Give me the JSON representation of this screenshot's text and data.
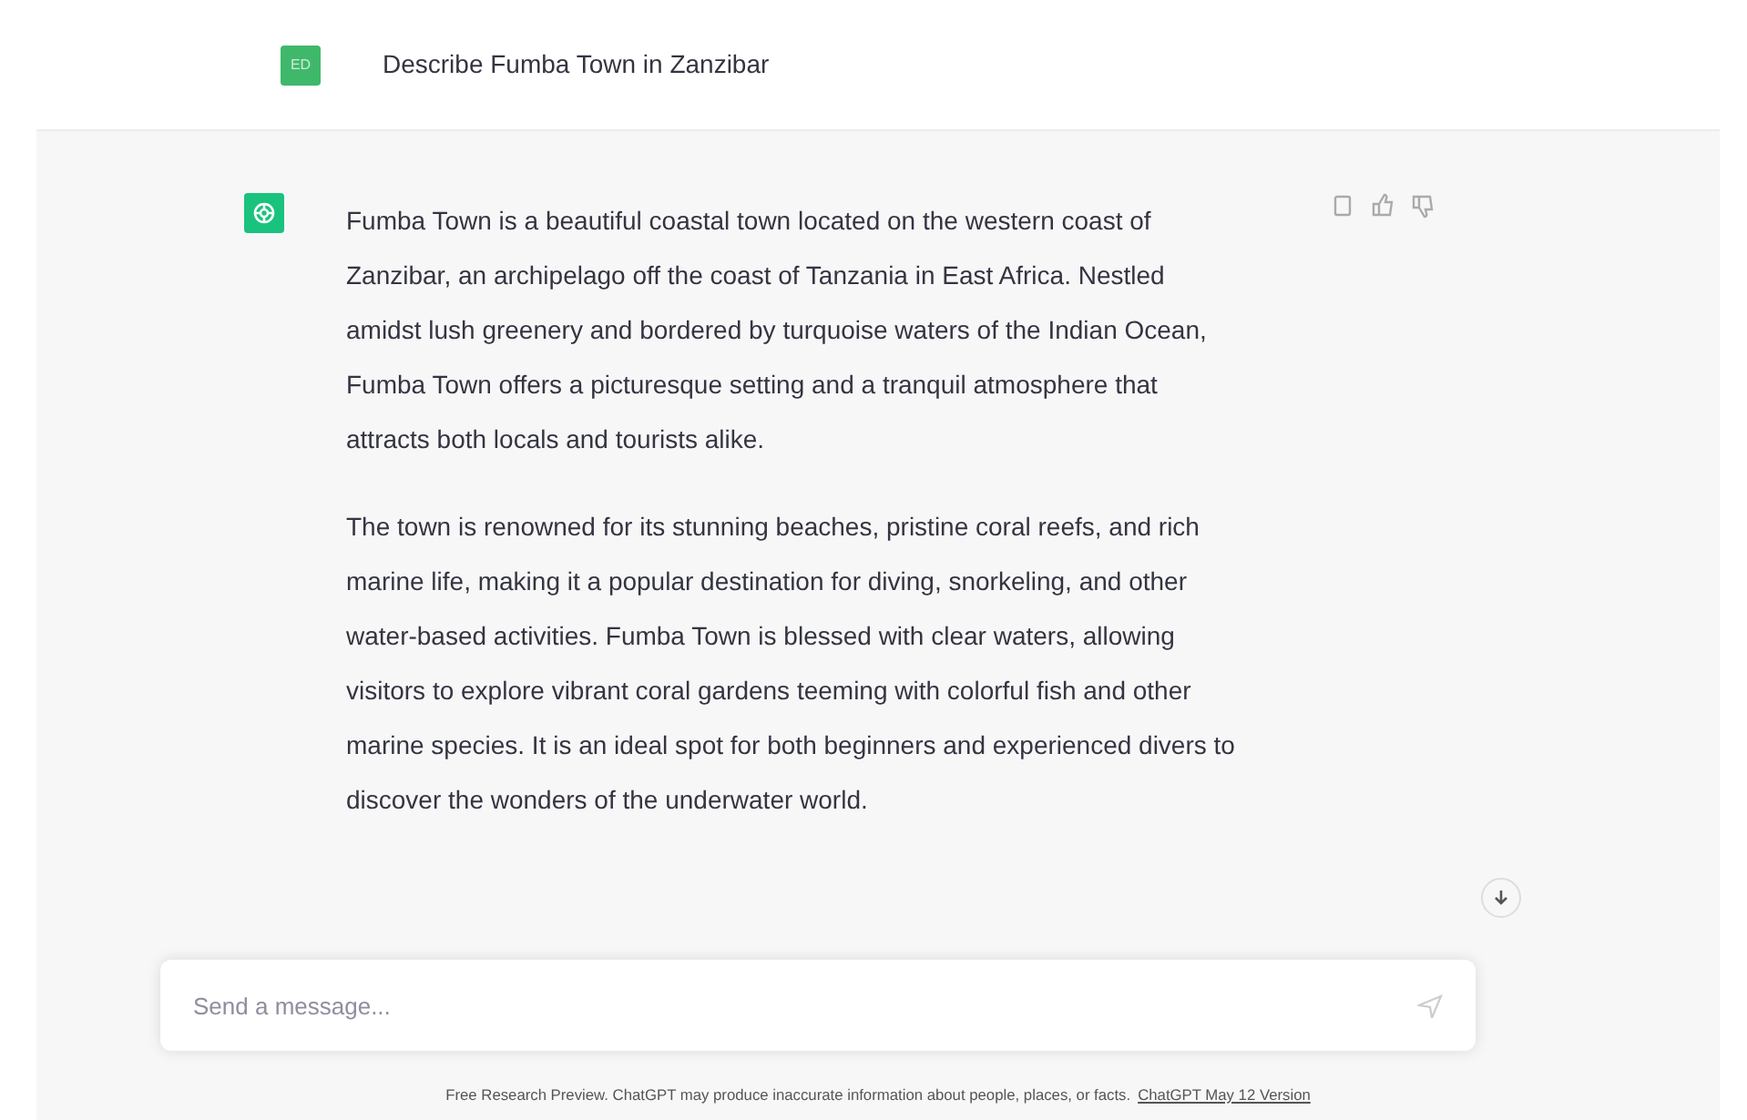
{
  "user_message": {
    "avatar": "ED",
    "text": "Describe Fumba Town in Zanzibar"
  },
  "assistant_message": {
    "paragraphs": [
      "Fumba Town is a beautiful coastal town located on the western coast of Zanzibar, an archipelago off the coast of Tanzania in East Africa. Nestled amidst lush greenery and bordered by turquoise waters of the Indian Ocean, Fumba Town offers a picturesque setting and a tranquil atmosphere that attracts both locals and tourists alike.",
      "The town is renowned for its stunning beaches, pristine coral reefs, and rich marine life, making it a popular destination for diving, snorkeling, and other water-based activities. Fumba Town is blessed with clear waters, allowing visitors to explore vibrant coral gardens teeming with colorful fish and other marine species. It is an ideal spot for both beginners and experienced divers to discover the wonders of the underwater world."
    ]
  },
  "composer": {
    "placeholder": "Send a message..."
  },
  "footer": {
    "text": "Free Research Preview. ChatGPT may produce inaccurate information about people, places, or facts.",
    "link": "ChatGPT May 12 Version"
  }
}
